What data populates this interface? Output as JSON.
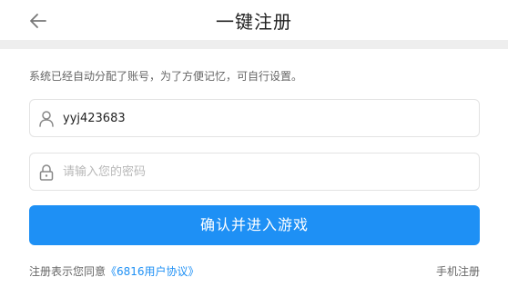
{
  "header": {
    "title": "一键注册",
    "back_icon": "arrow-left-icon"
  },
  "notice": "系统已经自动分配了账号，为了方便记忆，可自行设置。",
  "form": {
    "username": {
      "value": "yyj423683",
      "icon": "user-icon"
    },
    "password": {
      "value": "",
      "placeholder": "请输入您的密码",
      "icon": "lock-icon"
    },
    "submit_label": "确认并进入游戏"
  },
  "footer": {
    "agreement_prefix": "注册表示您同意",
    "agreement_link": "《6816用户协议》",
    "phone_register": "手机注册"
  },
  "colors": {
    "accent": "#1e90f5",
    "divider": "#eeeeee",
    "border": "#e3e3e3"
  }
}
